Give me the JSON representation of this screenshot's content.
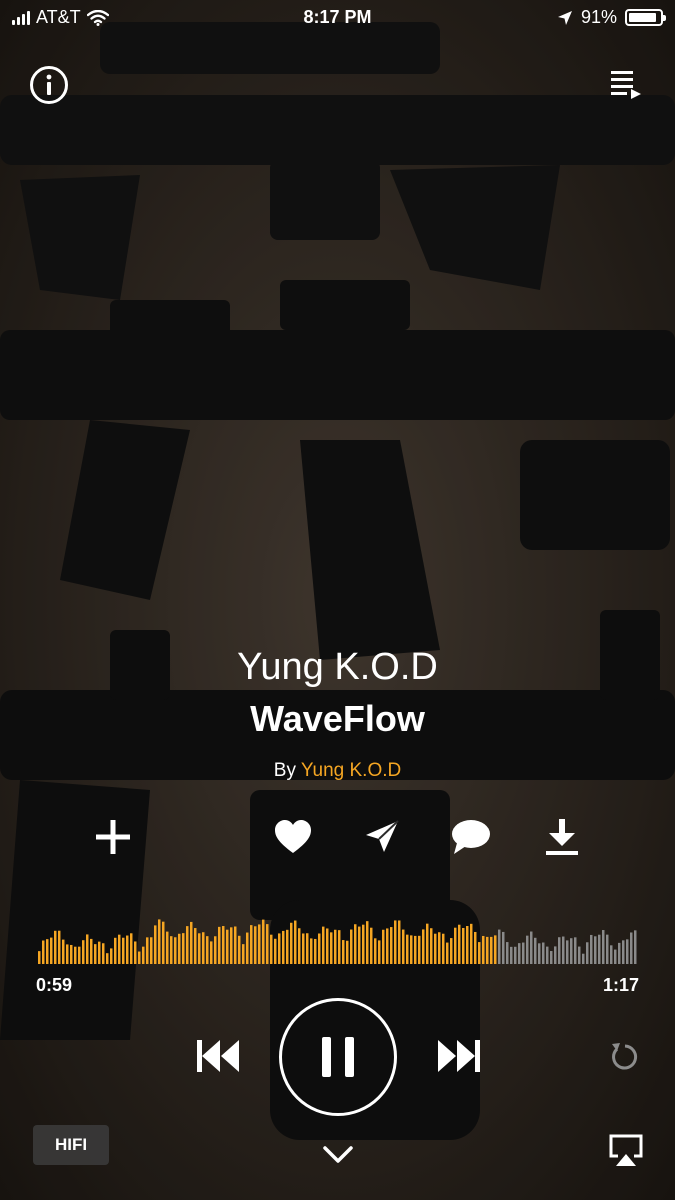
{
  "status_bar": {
    "carrier": "AT&T",
    "time": "8:17 PM",
    "battery_text": "91%",
    "battery_level": 0.91
  },
  "track": {
    "artist_heading": "Yung K.O.D",
    "title": "WaveFlow",
    "by_prefix": "By",
    "by_artist": "Yung K.O.D"
  },
  "playback": {
    "elapsed": "0:59",
    "duration": "1:17",
    "progress": 0.766,
    "state": "playing"
  },
  "quality_label": "HIFI",
  "colors": {
    "accent": "#f5a623",
    "wave_unplayed": "#8a8a8a",
    "text": "#ffffff"
  },
  "icons": [
    "info-icon",
    "queue-icon",
    "plus-icon",
    "heart-icon",
    "share-icon",
    "comment-icon",
    "download-icon",
    "previous-icon",
    "pause-icon",
    "next-icon",
    "repeat-icon",
    "chevron-down-icon",
    "airplay-icon"
  ]
}
